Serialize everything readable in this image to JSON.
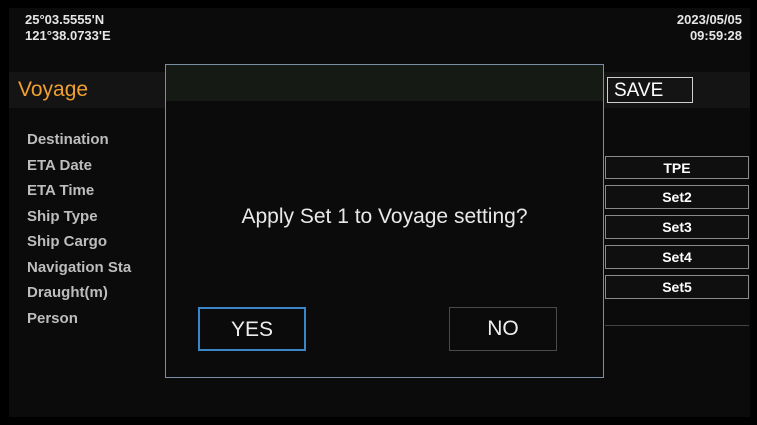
{
  "status": {
    "lat": "25°03.5555'N",
    "lon": "121°38.0733'E",
    "date": "2023/05/05",
    "time": "09:59:28"
  },
  "page": {
    "title": "Voyage",
    "save_label": "SAVE"
  },
  "fields": [
    {
      "label": "Destination"
    },
    {
      "label": "ETA Date"
    },
    {
      "label": "ETA Time"
    },
    {
      "label": "Ship Type"
    },
    {
      "label": "Ship Cargo"
    },
    {
      "label": "Navigation Sta"
    },
    {
      "label": "Draught(m)"
    },
    {
      "label": "Person"
    }
  ],
  "sets": [
    {
      "label": "TPE"
    },
    {
      "label": "Set2"
    },
    {
      "label": "Set3"
    },
    {
      "label": "Set4"
    },
    {
      "label": "Set5"
    }
  ],
  "dialog": {
    "message": "Apply Set 1 to Voyage setting?",
    "yes_label": "YES",
    "no_label": "NO"
  },
  "colors": {
    "title": "#f0a030",
    "focus": "#3a86c8",
    "dialog_border": "#7a8ea6"
  }
}
